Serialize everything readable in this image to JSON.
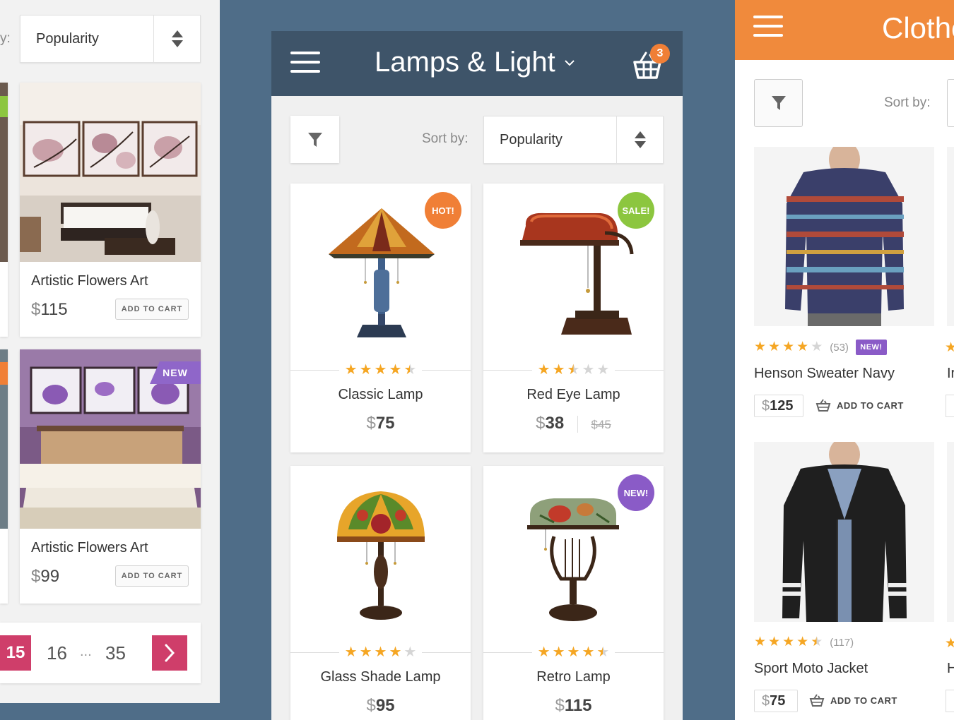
{
  "left": {
    "sort_label_fragment": "y:",
    "sort_value": "Popularity",
    "cards": [
      {
        "title": "Artistic Flowers Art",
        "currency": "$",
        "price": "115",
        "button": "ADD TO CART"
      },
      {
        "title": "Artistic Flowers Art",
        "currency": "$",
        "price": "99",
        "button": "ADD TO CART",
        "ribbon": "NEW"
      }
    ],
    "pager": {
      "current": "15",
      "next_page": "16",
      "ellipsis": "...",
      "last": "35"
    }
  },
  "middle": {
    "title": "Lamps & Light",
    "cart_count": "3",
    "sort_label": "Sort by:",
    "sort_value": "Popularity",
    "products": [
      {
        "name": "Classic Lamp",
        "currency": "$",
        "price": "75",
        "rating": 4.5,
        "badge": "HOT!",
        "badge_color": "#f07f36"
      },
      {
        "name": "Red Eye Lamp",
        "currency": "$",
        "price": "38",
        "old_price": "$45",
        "rating": 2.5,
        "badge": "SALE!",
        "badge_color": "#8cc63f"
      },
      {
        "name": "Glass Shade Lamp",
        "currency": "$",
        "price": "95",
        "rating": 4
      },
      {
        "name": "Retro Lamp",
        "currency": "$",
        "price": "115",
        "rating": 4.5,
        "badge": "NEW!",
        "badge_color": "#8a5bc7"
      }
    ]
  },
  "right": {
    "title": "Clothe",
    "sort_label": "Sort by:",
    "products": [
      {
        "name": "Henson Sweater Navy",
        "rating": 4,
        "reviews": "(53)",
        "tag": "NEW!",
        "currency": "$",
        "price": "125",
        "button": "ADD TO CART",
        "name_fragment": "Ir"
      },
      {
        "name": "Sport Moto Jacket",
        "rating": 4.5,
        "reviews": "(117)",
        "currency": "$",
        "price": "75",
        "button": "ADD TO CART",
        "name_fragment": "H"
      }
    ]
  },
  "colors": {
    "background": "#4f6d88",
    "mid_header": "#3e5469",
    "right_header": "#f08a3c",
    "pager_accent": "#cf3e6a",
    "star": "#f5a623"
  }
}
